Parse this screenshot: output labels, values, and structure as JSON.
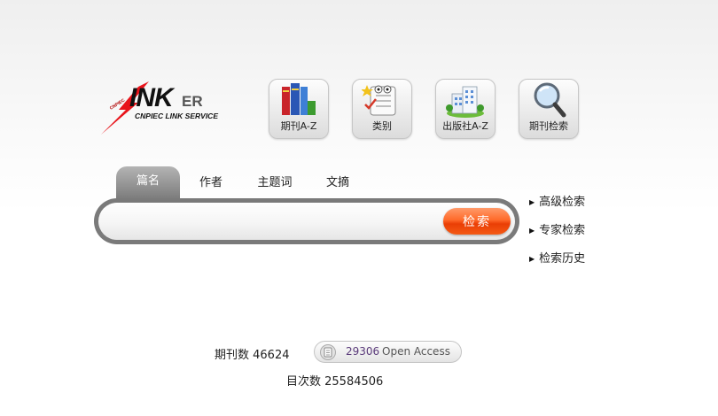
{
  "logo": {
    "word": "INK",
    "suffix": "ER",
    "subtitle": "CNPIEC LINK SERVICE",
    "mark": "CNPIEC"
  },
  "nav": [
    {
      "label": "期刊A-Z",
      "icon": "books-icon"
    },
    {
      "label": "类别",
      "icon": "category-list-icon"
    },
    {
      "label": "出版社A-Z",
      "icon": "building-icon"
    },
    {
      "label": "期刊检索",
      "icon": "magnifier-icon"
    }
  ],
  "tabs": [
    {
      "label": "篇名",
      "active": true
    },
    {
      "label": "作者",
      "active": false
    },
    {
      "label": "主题词",
      "active": false
    },
    {
      "label": "文摘",
      "active": false
    }
  ],
  "search": {
    "value": "",
    "placeholder": "",
    "button_label": "检索"
  },
  "side_links": [
    {
      "label": "高级检索"
    },
    {
      "label": "专家检索"
    },
    {
      "label": "检索历史"
    }
  ],
  "stats": {
    "journals": "期刊数 46624",
    "toc": "目次数 25584506",
    "open_access_count": "29306",
    "open_access_label": "Open Access"
  },
  "colors": {
    "accent": "#f05a1a",
    "search_border": "#7a7a7a",
    "active_tab": "#8f8f8f",
    "logo_bolt": "#e8131a"
  }
}
